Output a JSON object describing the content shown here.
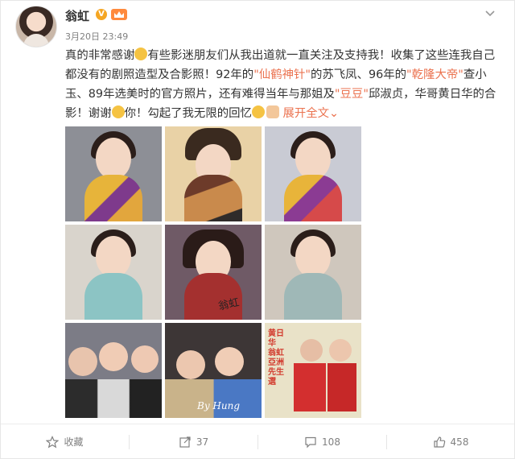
{
  "post": {
    "author": "翁虹",
    "verified_mark": "V",
    "timestamp": "3月20日 23:49",
    "text_1": "真的非常感谢",
    "text_2": "有些影迷朋友们从我出道就一直关注及支持我！收集了这些连我自己都没有的剧照造型及合影照！92年的",
    "link_1": "\"仙鹤神针\"",
    "text_3": "的苏飞凤、96年的",
    "link_2": "\"乾隆大帝\"",
    "text_4": "查小玉、89年选美时的官方照片，还有难得当年与那姐及",
    "link_3": "\"豆豆\"",
    "text_5": "邱淑贞，华哥黄日华的合影！谢谢",
    "text_6": "你！勾起了我无限的回忆",
    "expand_label": "展开全文",
    "expand_arrow": "⌄"
  },
  "photo_texts": {
    "signature_1": "翁虹",
    "signature_2": "By Hung",
    "poster_caption": "黄日华 翁虹 亞洲先生選",
    "poster_caption_2": "亞洲先生選"
  },
  "actions": {
    "favorite_label": "收藏",
    "repost_count": "37",
    "comment_count": "108",
    "like_count": "458"
  },
  "colors": {
    "link": "#eb7350",
    "muted": "#808080",
    "verified": "#f5a623"
  },
  "icons": [
    "chevron-down-icon",
    "favorite-icon",
    "repost-icon",
    "comment-icon",
    "like-icon",
    "emoji-icon"
  ]
}
